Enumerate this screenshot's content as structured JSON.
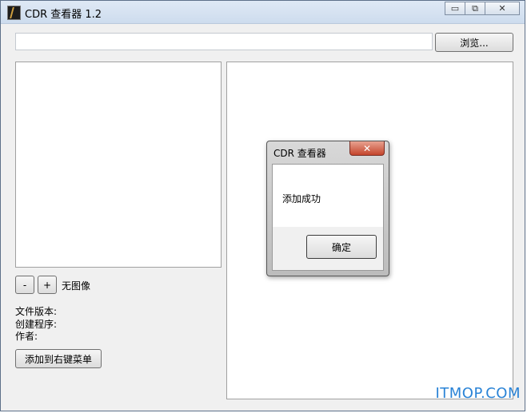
{
  "window": {
    "title": "CDR 查看器 1.2",
    "controls": {
      "minimize": "▭",
      "restore": "⧉",
      "close": "✕"
    }
  },
  "toolbar": {
    "path_value": "",
    "browse_label": "浏览..."
  },
  "preview": {
    "zoom_out_label": "-",
    "zoom_in_label": "+",
    "status": "无图像"
  },
  "info": {
    "file_version_label": "文件版本:",
    "creator_label": "创建程序:",
    "author_label": "作者:"
  },
  "actions": {
    "add_context_menu_label": "添加到右键菜单"
  },
  "dialog": {
    "title": "CDR 查看器",
    "close_glyph": "✕",
    "message": "添加成功",
    "ok_label": "确定"
  },
  "watermark": "ITMOP.COM",
  "colors": {
    "titlebar": "#cddcee",
    "dialog_close": "#c4452c",
    "watermark": "#2a83d6"
  }
}
